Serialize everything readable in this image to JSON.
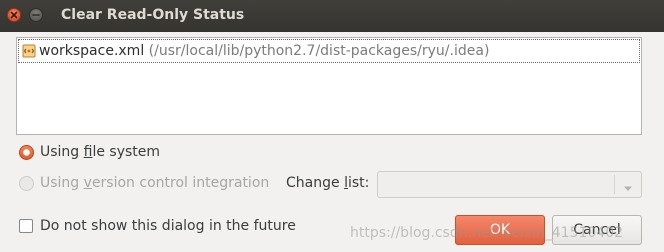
{
  "window": {
    "title": "Clear Read-Only Status",
    "controls": [
      "close-icon",
      "minimize-icon"
    ]
  },
  "file_list": {
    "items": [
      {
        "icon": "xml-file-icon",
        "name": "workspace.xml",
        "path": " (/usr/local/lib/python2.7/dist-packages/ryu/.idea)"
      }
    ]
  },
  "options": {
    "file_system": {
      "pre": "Using ",
      "mnemonic": "f",
      "post": "ile system",
      "selected": true,
      "enabled": true
    },
    "vcs": {
      "pre": "Using ",
      "mnemonic": "v",
      "post": "ersion control integration",
      "selected": false,
      "enabled": false
    }
  },
  "change_list": {
    "pre": "Change ",
    "mnemonic": "l",
    "post": "ist:",
    "value": "",
    "enabled": false
  },
  "dont_show": {
    "label": "Do not show this dialog in the future",
    "checked": false
  },
  "buttons": {
    "ok": "OK",
    "cancel": "Cancel"
  },
  "watermark": "https://blog.csdn.net/weixin_41510402",
  "colors": {
    "titlebar": "#3c3b37",
    "accent": "#e4603d",
    "window_bg": "#f2f1f0"
  }
}
